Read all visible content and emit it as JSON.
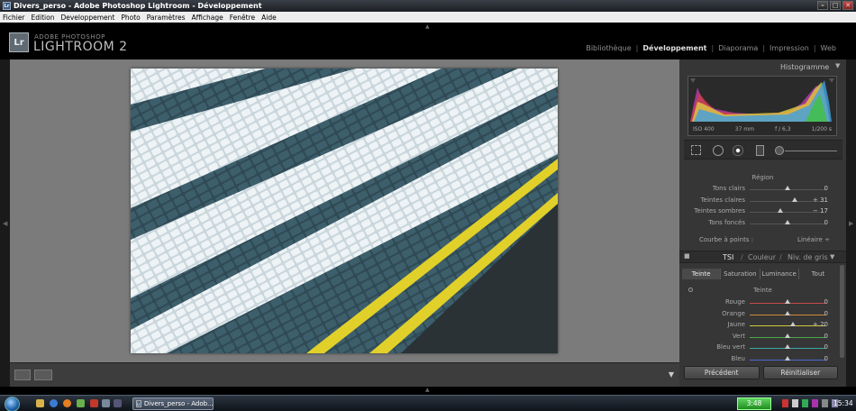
{
  "window": {
    "title": "Divers_perso - Adobe Photoshop Lightroom - Développement",
    "app_icon": "Lr"
  },
  "menu": [
    "Fichier",
    "Edition",
    "Developpement",
    "Photo",
    "Paramètres",
    "Affichage",
    "Fenêtre",
    "Aide"
  ],
  "brand": {
    "badge": "Lr",
    "top": "ADOBE PHOTOSHOP",
    "main": "LIGHTROOM 2"
  },
  "modules": [
    {
      "label": "Bibliothèque",
      "active": false
    },
    {
      "label": "Développement",
      "active": true
    },
    {
      "label": "Diaporama",
      "active": false
    },
    {
      "label": "Impression",
      "active": false
    },
    {
      "label": "Web",
      "active": false
    }
  ],
  "histogram": {
    "title": "Histogramme",
    "iso": "ISO 400",
    "focal": "37 mm",
    "aperture": "f / 6,3",
    "shutter": "1/200 s"
  },
  "region": {
    "title": "Région",
    "sliders": [
      {
        "label": "Tons clairs",
        "value": "0",
        "pos": 0.5
      },
      {
        "label": "Teintes claires",
        "value": "+ 31",
        "pos": 0.6
      },
      {
        "label": "Teintes sombres",
        "value": "− 17",
        "pos": 0.41
      },
      {
        "label": "Tons foncés",
        "value": "0",
        "pos": 0.5
      }
    ]
  },
  "curve": {
    "label": "Courbe à points :",
    "value": "Linéaire ÷"
  },
  "tsi": {
    "tabs": [
      "TSI",
      "Couleur",
      "Niv. de gris"
    ],
    "subtabs": [
      "Teinte",
      "Saturation",
      "Luminance",
      "Tout"
    ],
    "section_title": "Teinte",
    "sliders": [
      {
        "label": "Rouge",
        "value": "0",
        "pos": 0.5,
        "color": "#c84a4a"
      },
      {
        "label": "Orange",
        "value": "0",
        "pos": 0.5,
        "color": "#d08a3a"
      },
      {
        "label": "Jaune",
        "value": "+ 20",
        "pos": 0.57,
        "color": "#d2c83a"
      },
      {
        "label": "Vert",
        "value": "0",
        "pos": 0.5,
        "color": "#4aa84a"
      },
      {
        "label": "Bleu vert",
        "value": "0",
        "pos": 0.5,
        "color": "#3aa8a8"
      },
      {
        "label": "Bleu",
        "value": "0",
        "pos": 0.5,
        "color": "#4a6ad0"
      }
    ]
  },
  "buttons": {
    "previous": "Précédent",
    "reset": "Réinitialiser"
  },
  "taskbar": {
    "task_label": "Divers_perso - Adob...",
    "green_clock": "3:48",
    "time": "15:34"
  },
  "colors": {
    "canvas": "#7b7b7b",
    "panel": "#363636",
    "stripe_yellow": "#e1d02a"
  }
}
